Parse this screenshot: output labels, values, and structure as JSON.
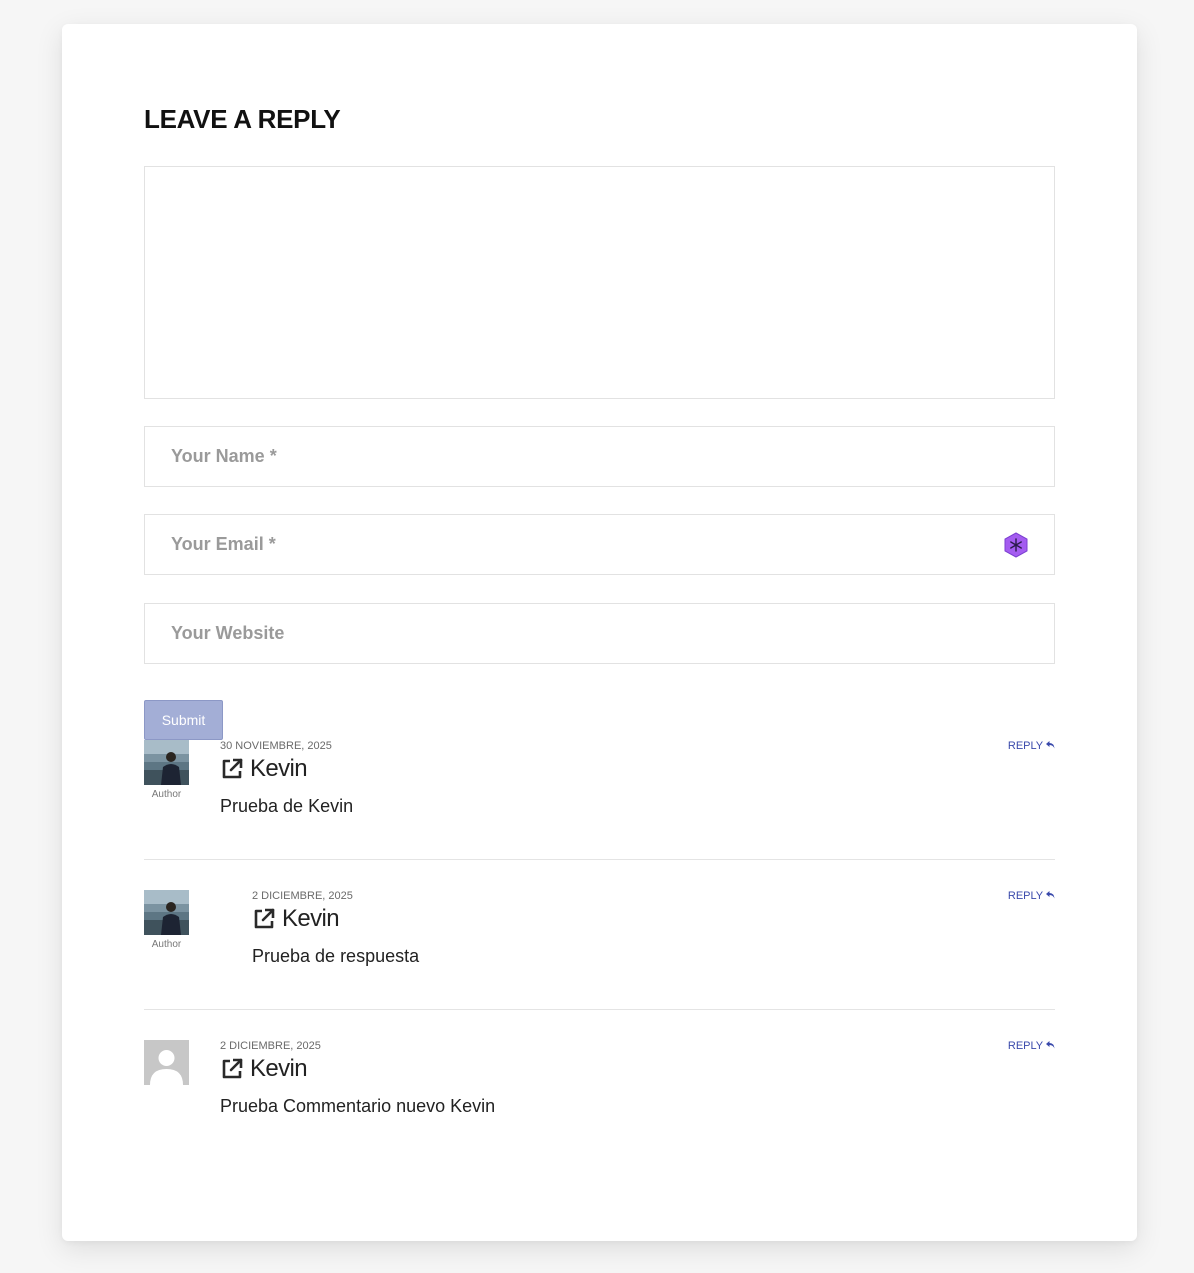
{
  "form": {
    "title": "LEAVE A REPLY",
    "comment_placeholder": "",
    "name_placeholder": "Your Name *",
    "email_placeholder": "Your Email *",
    "website_placeholder": "Your Website",
    "submit_label": "Submit",
    "accent_color": "#a3aed6"
  },
  "comments": [
    {
      "date": "30 NOVIEMBRE, 2025",
      "author": "Kevin",
      "text": "Prueba de Kevin",
      "reply_label": "REPLY",
      "avatar_label": "Author",
      "avatar": "photo",
      "nested": false
    },
    {
      "date": "2 DICIEMBRE, 2025",
      "author": "Kevin",
      "text": "Prueba de respuesta",
      "reply_label": "REPLY",
      "avatar_label": "Author",
      "avatar": "photo",
      "nested": true
    },
    {
      "date": "2 DICIEMBRE, 2025",
      "author": "Kevin",
      "text": "Prueba Commentario nuevo Kevin",
      "reply_label": "REPLY",
      "avatar_label": "",
      "avatar": "placeholder",
      "nested": false
    }
  ],
  "icons": {
    "author_link": "external-link-icon",
    "reply": "reply-arrow-icon",
    "email_extension": "extension-hexagon-icon",
    "link_color": "#3949ab"
  }
}
